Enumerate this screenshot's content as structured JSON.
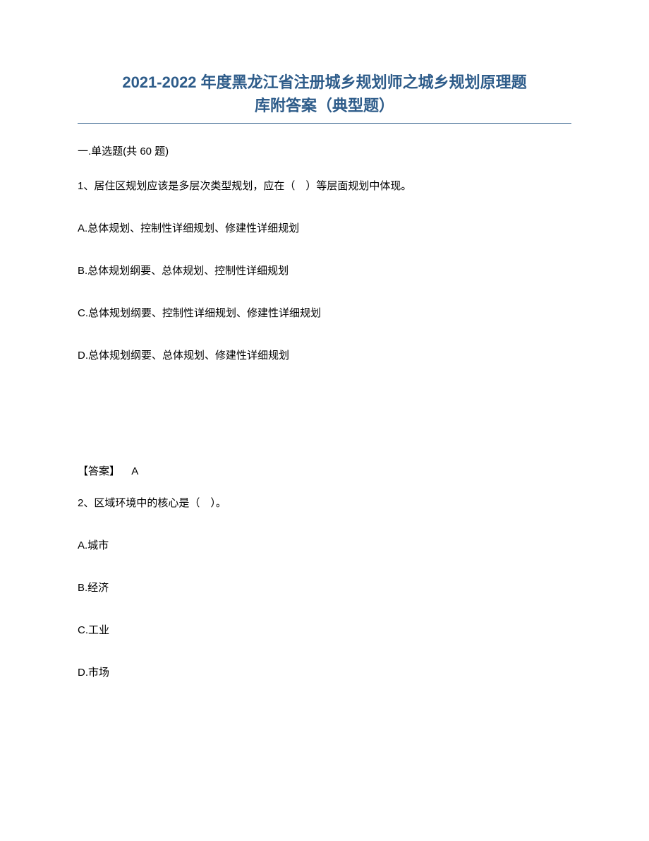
{
  "title_line1": "2021-2022 年度黑龙江省注册城乡规划师之城乡规划原理题",
  "title_line2": "库附答案（典型题）",
  "section_header": "一.单选题(共 60 题)",
  "question1": {
    "stem": "1、居住区规划应该是多层次类型规划，应在（　）等层面规划中体现。",
    "options": {
      "A": "A.总体规划、控制性详细规划、修建性详细规划",
      "B": "B.总体规划纲要、总体规划、控制性详细规划",
      "C": "C.总体规划纲要、控制性详细规划、修建性详细规划",
      "D": "D.总体规划纲要、总体规划、修建性详细规划"
    },
    "answer_label": "【答案】",
    "answer_value": "A"
  },
  "question2": {
    "stem": "2、区域环境中的核心是（　）。",
    "options": {
      "A": "A.城市",
      "B": "B.经济",
      "C": "C.工业",
      "D": "D.市场"
    }
  }
}
